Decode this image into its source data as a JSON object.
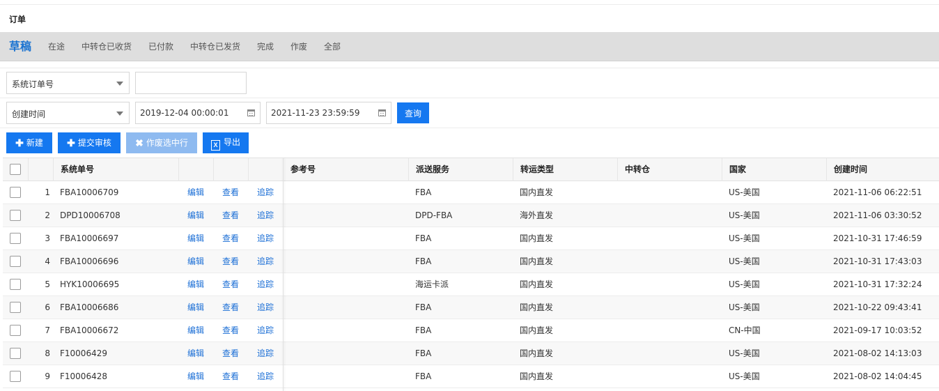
{
  "page": {
    "title": "订单"
  },
  "tabs": [
    {
      "label": "草稿",
      "active": true
    },
    {
      "label": "在途",
      "active": false
    },
    {
      "label": "中转仓已收货",
      "active": false
    },
    {
      "label": "已付款",
      "active": false
    },
    {
      "label": "中转仓已发货",
      "active": false
    },
    {
      "label": "完成",
      "active": false
    },
    {
      "label": "作废",
      "active": false
    },
    {
      "label": "全部",
      "active": false
    }
  ],
  "filters": {
    "field_select": {
      "value": "系统订单号"
    },
    "field_input": {
      "value": "",
      "placeholder": ""
    },
    "time_select": {
      "value": "创建时间"
    },
    "date_from": "2019-12-04 00:00:01",
    "date_to": "2021-11-23 23:59:59",
    "query_label": "查询"
  },
  "toolbar": {
    "new_label": "新建",
    "submit_label": "提交审核",
    "void_label": "作废选中行",
    "export_label": "导出"
  },
  "table": {
    "columns": [
      "系统单号",
      "参考号",
      "派送服务",
      "转运类型",
      "中转仓",
      "国家",
      "创建时间"
    ],
    "actions": {
      "edit": "编辑",
      "view": "查看",
      "track": "追踪"
    },
    "rows": [
      {
        "no": "1",
        "order": "FBA10006709",
        "ref": "",
        "service": "FBA",
        "type": "国内直发",
        "warehouse": "",
        "country": "US-美国",
        "created": "2021-11-06 06:22:51"
      },
      {
        "no": "2",
        "order": "DPD10006708",
        "ref": "",
        "service": "DPD-FBA",
        "type": "海外直发",
        "warehouse": "",
        "country": "US-美国",
        "created": "2021-11-06 03:30:52"
      },
      {
        "no": "3",
        "order": "FBA10006697",
        "ref": "",
        "service": "FBA",
        "type": "国内直发",
        "warehouse": "",
        "country": "US-美国",
        "created": "2021-10-31 17:46:59"
      },
      {
        "no": "4",
        "order": "FBA10006696",
        "ref": "",
        "service": "FBA",
        "type": "国内直发",
        "warehouse": "",
        "country": "US-美国",
        "created": "2021-10-31 17:43:03"
      },
      {
        "no": "5",
        "order": "HYK10006695",
        "ref": "",
        "service": "海运卡派",
        "type": "国内直发",
        "warehouse": "",
        "country": "US-美国",
        "created": "2021-10-31 17:32:24"
      },
      {
        "no": "6",
        "order": "FBA10006686",
        "ref": "",
        "service": "FBA",
        "type": "国内直发",
        "warehouse": "",
        "country": "US-美国",
        "created": "2021-10-22 09:43:41"
      },
      {
        "no": "7",
        "order": "FBA10006672",
        "ref": "",
        "service": "FBA",
        "type": "国内直发",
        "warehouse": "",
        "country": "CN-中国",
        "created": "2021-09-17 10:03:52"
      },
      {
        "no": "8",
        "order": "F10006429",
        "ref": "",
        "service": "FBA",
        "type": "国内直发",
        "warehouse": "",
        "country": "US-美国",
        "created": "2021-08-02 14:13:03"
      },
      {
        "no": "9",
        "order": "F10006428",
        "ref": "",
        "service": "FBA",
        "type": "国内直发",
        "warehouse": "",
        "country": "US-美国",
        "created": "2021-08-02 14:04:45"
      }
    ]
  }
}
